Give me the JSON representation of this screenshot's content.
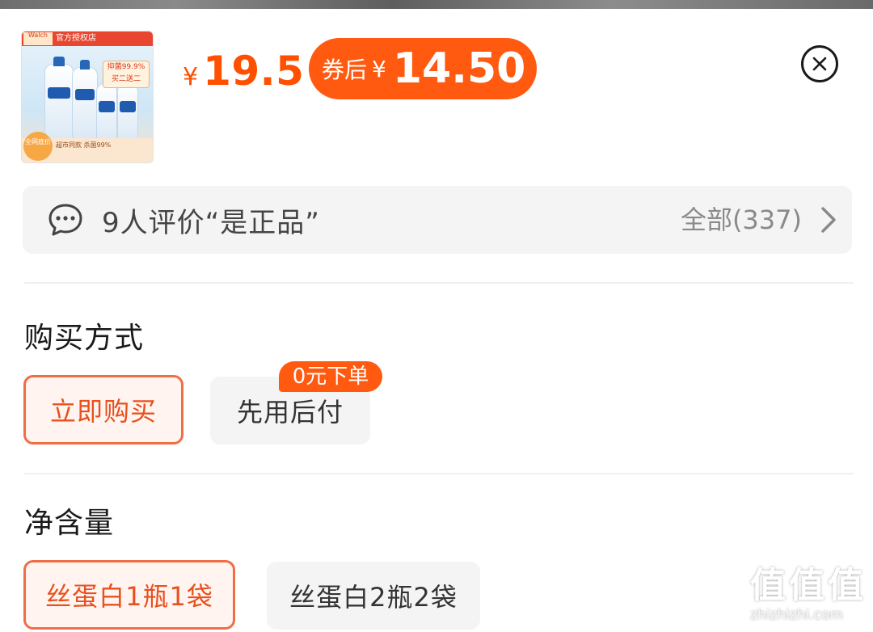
{
  "product": {
    "thumb_banner": "官方授权店",
    "thumb_brand": "Walch",
    "thumb_promo": "抑菌99.9% 买二送二",
    "thumb_footer": "超市同款 杀菌99%",
    "thumb_seal": "全网底价",
    "price_symbol": "¥",
    "price": "19.5",
    "coupon_label": "券后",
    "coupon_symbol": "¥",
    "coupon_price": "14.50"
  },
  "review": {
    "text": "9人评价“是正品”",
    "all_label": "全部(337)"
  },
  "purchase": {
    "title": "购买方式",
    "options": [
      "立即购买",
      "先用后付"
    ],
    "badge": "0元下单",
    "selected_index": 0
  },
  "volume": {
    "title": "净含量",
    "options": [
      "丝蛋白1瓶1袋",
      "丝蛋白2瓶2袋"
    ],
    "selected_index": 0
  },
  "watermark": {
    "big": "值值值",
    "small": "zhizhizhi.com"
  },
  "colors": {
    "accent": "#ff5000",
    "coupon_bg": "#ff5a10",
    "selected_border": "#f06e45",
    "option_bg": "#f4f4f4"
  },
  "icons": {
    "close": "close-circle-icon",
    "review": "chat-bubble-icon",
    "more": "chevron-right-icon"
  }
}
